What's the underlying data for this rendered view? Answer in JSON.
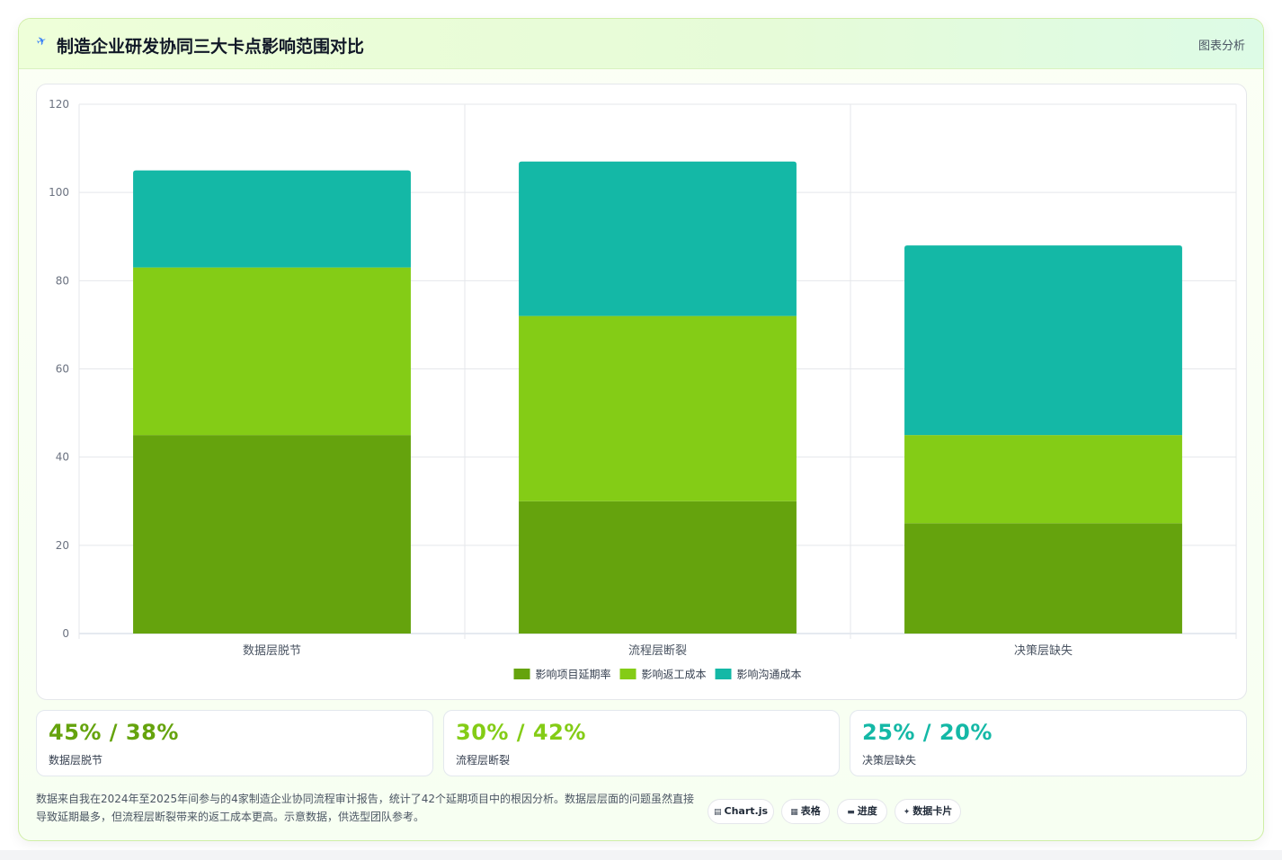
{
  "header": {
    "title": "制造企业研发协同三大卡点影响范围对比",
    "action": "图表分析"
  },
  "chart_data": {
    "type": "bar",
    "stacked": true,
    "categories": [
      "数据层脱节",
      "流程层断裂",
      "决策层缺失"
    ],
    "series": [
      {
        "name": "影响项目延期率",
        "values": [
          45,
          30,
          25
        ],
        "color": "#65a30d"
      },
      {
        "name": "影响返工成本",
        "values": [
          38,
          42,
          20
        ],
        "color": "#84cc16"
      },
      {
        "name": "影响沟通成本",
        "values": [
          22,
          35,
          43
        ],
        "color": "#14b8a6"
      }
    ],
    "ylim": [
      0,
      120
    ],
    "yticks": [
      "0",
      "20",
      "40",
      "60",
      "80",
      "100",
      "120"
    ],
    "grid": true,
    "legend": "bottom"
  },
  "kpis": [
    {
      "value": "45% / 38%",
      "label": "数据层脱节",
      "color": "#65a30d"
    },
    {
      "value": "30% / 42%",
      "label": "流程层断裂",
      "color": "#84cc16"
    },
    {
      "value": "25% / 20%",
      "label": "决策层缺失",
      "color": "#14b8a6"
    }
  ],
  "footnote": "数据来自我在2024年至2025年间参与的4家制造企业协同流程审计报告，统计了42个延期项目中的根因分析。数据层层面的问题虽然直接导致延期最多，但流程层断裂带来的返工成本更高。示意数据，供选型团队参考。",
  "chips": [
    {
      "icon": "▤",
      "label": "Chart.js"
    },
    {
      "icon": "▦",
      "label": "表格"
    },
    {
      "icon": "▬",
      "label": "进度"
    },
    {
      "icon": "✦",
      "label": "数据卡片"
    }
  ]
}
